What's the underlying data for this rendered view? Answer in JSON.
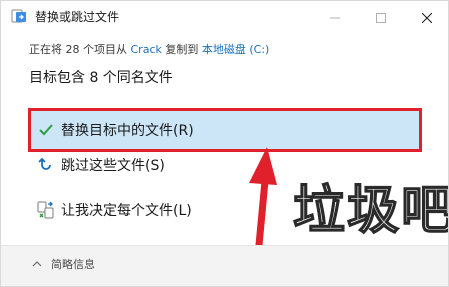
{
  "window": {
    "title": "替换或跳过文件",
    "icons": {
      "app": "file-move-icon",
      "minimize": "minimize-icon",
      "maximize": "maximize-icon",
      "close": "close-icon"
    }
  },
  "status": {
    "prefix": "正在将 28 个项目从",
    "source": "Crack",
    "middle": "复制到",
    "destination": "本地磁盘 (C:)"
  },
  "headline": "目标包含 8 个同名文件",
  "options": {
    "replace": {
      "label": "替换目标中的文件(R)",
      "icon": "checkmark-icon",
      "icon_color": "#2e9e44"
    },
    "skip": {
      "label": "跳过这些文件(S)",
      "icon": "skip-arrow-icon",
      "icon_color": "#1a6fb8"
    },
    "decide": {
      "label": "让我决定每个文件(L)",
      "icon": "compare-files-icon",
      "icon_color": "#2e9e44"
    }
  },
  "overlay": {
    "watermark_text": "垃圾吧",
    "highlight_color": "#e0202a"
  },
  "footer": {
    "details_label": "简略信息",
    "details_icon": "chevron-up-icon"
  }
}
